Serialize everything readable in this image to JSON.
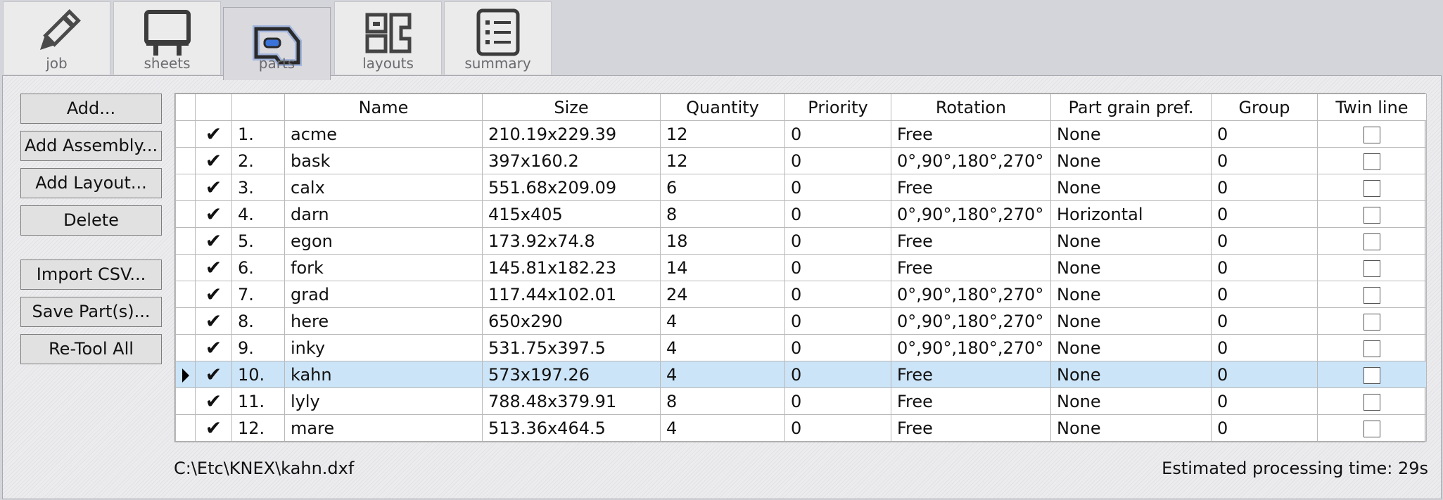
{
  "tabs": [
    {
      "label": "job",
      "icon": "pencil-icon",
      "active": false
    },
    {
      "label": "sheets",
      "icon": "sheet-icon",
      "active": false
    },
    {
      "label": "parts",
      "icon": "part-icon",
      "active": true
    },
    {
      "label": "layouts",
      "icon": "layout-icon",
      "active": false
    },
    {
      "label": "summary",
      "icon": "list-icon",
      "active": false
    }
  ],
  "buttons": {
    "add": "Add...",
    "add_assembly": "Add Assembly...",
    "add_layout": "Add Layout...",
    "delete": "Delete",
    "import_csv": "Import CSV...",
    "save_parts": "Save Part(s)...",
    "retool_all": "Re-Tool All"
  },
  "columns": [
    "Name",
    "Size",
    "Quantity",
    "Priority",
    "Rotation",
    "Part grain pref.",
    "Group",
    "Twin line"
  ],
  "rows": [
    {
      "num": "1.",
      "name": "acme",
      "size": "210.19x229.39",
      "qty": "12",
      "priority": "0",
      "rotation": "Free",
      "grain": "None",
      "group": "0",
      "twin": false,
      "checked": true
    },
    {
      "num": "2.",
      "name": "bask",
      "size": "397x160.2",
      "qty": "12",
      "priority": "0",
      "rotation": "0°,90°,180°,270°",
      "grain": "None",
      "group": "0",
      "twin": false,
      "checked": true
    },
    {
      "num": "3.",
      "name": "calx",
      "size": "551.68x209.09",
      "qty": "6",
      "priority": "0",
      "rotation": "Free",
      "grain": "None",
      "group": "0",
      "twin": false,
      "checked": true
    },
    {
      "num": "4.",
      "name": "darn",
      "size": "415x405",
      "qty": "8",
      "priority": "0",
      "rotation": "0°,90°,180°,270°",
      "grain": "Horizontal",
      "group": "0",
      "twin": false,
      "checked": true
    },
    {
      "num": "5.",
      "name": "egon",
      "size": "173.92x74.8",
      "qty": "18",
      "priority": "0",
      "rotation": "Free",
      "grain": "None",
      "group": "0",
      "twin": false,
      "checked": true
    },
    {
      "num": "6.",
      "name": "fork",
      "size": "145.81x182.23",
      "qty": "14",
      "priority": "0",
      "rotation": "Free",
      "grain": "None",
      "group": "0",
      "twin": false,
      "checked": true
    },
    {
      "num": "7.",
      "name": "grad",
      "size": "117.44x102.01",
      "qty": "24",
      "priority": "0",
      "rotation": "0°,90°,180°,270°",
      "grain": "None",
      "group": "0",
      "twin": false,
      "checked": true
    },
    {
      "num": "8.",
      "name": "here",
      "size": "650x290",
      "qty": "4",
      "priority": "0",
      "rotation": "0°,90°,180°,270°",
      "grain": "None",
      "group": "0",
      "twin": false,
      "checked": true
    },
    {
      "num": "9.",
      "name": "inky",
      "size": "531.75x397.5",
      "qty": "4",
      "priority": "0",
      "rotation": "0°,90°,180°,270°",
      "grain": "None",
      "group": "0",
      "twin": false,
      "checked": true
    },
    {
      "num": "10.",
      "name": "kahn",
      "size": "573x197.26",
      "qty": "4",
      "priority": "0",
      "rotation": "Free",
      "grain": "None",
      "group": "0",
      "twin": false,
      "checked": true,
      "current": true
    },
    {
      "num": "11.",
      "name": "lyly",
      "size": "788.48x379.91",
      "qty": "8",
      "priority": "0",
      "rotation": "Free",
      "grain": "None",
      "group": "0",
      "twin": false,
      "checked": true
    },
    {
      "num": "12.",
      "name": "mare",
      "size": "513.36x464.5",
      "qty": "4",
      "priority": "0",
      "rotation": "Free",
      "grain": "None",
      "group": "0",
      "twin": false,
      "checked": true
    }
  ],
  "status": {
    "file_path": "C:\\Etc\\KNEX\\kahn.dxf",
    "estimate": "Estimated processing time: 29s"
  },
  "colors": {
    "selected_row": "#cce4f7",
    "panel": "#ececee",
    "tab_active": "#d9d9de",
    "accent_icon": "#3b74d9"
  }
}
